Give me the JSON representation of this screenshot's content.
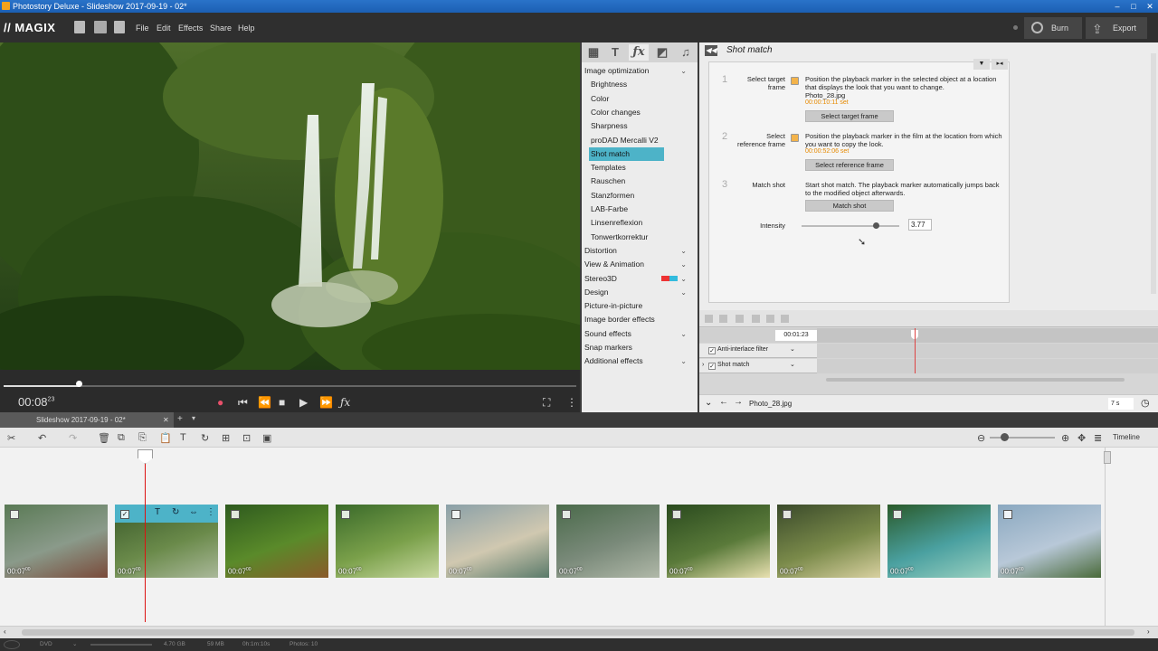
{
  "window": {
    "title": "Photostory Deluxe - Slideshow 2017-09-19 - 02*"
  },
  "menu": {
    "brand": "MAGIX",
    "items": [
      "File",
      "Edit",
      "Effects",
      "Share",
      "Help"
    ],
    "burn_label": "Burn",
    "export_label": "Export"
  },
  "player": {
    "timecode": "00:08",
    "timecode_frames": "23"
  },
  "effects": {
    "items": [
      {
        "label": "Image optimization",
        "type": "cat",
        "chevron": true
      },
      {
        "label": "Brightness",
        "type": "sub"
      },
      {
        "label": "Color",
        "type": "sub"
      },
      {
        "label": "Color changes",
        "type": "sub"
      },
      {
        "label": "Sharpness",
        "type": "sub"
      },
      {
        "label": "proDAD Mercalli V2",
        "type": "sub"
      },
      {
        "label": "Shot match",
        "type": "sub",
        "selected": true
      },
      {
        "label": "Templates",
        "type": "sub"
      },
      {
        "label": "Rauschen",
        "type": "sub"
      },
      {
        "label": "Stanzformen",
        "type": "sub"
      },
      {
        "label": "LAB-Farbe",
        "type": "sub"
      },
      {
        "label": "Linsenreflexion",
        "type": "sub"
      },
      {
        "label": "Tonwertkorrektur",
        "type": "sub"
      },
      {
        "label": "Distortion",
        "type": "cat",
        "chevron": true
      },
      {
        "label": "View & Animation",
        "type": "cat",
        "chevron": true
      },
      {
        "label": "Stereo3D",
        "type": "cat",
        "chevron": true
      },
      {
        "label": "Design",
        "type": "cat",
        "chevron": true
      },
      {
        "label": "Picture-in-picture",
        "type": "cat"
      },
      {
        "label": "Image border effects",
        "type": "cat"
      },
      {
        "label": "Sound effects",
        "type": "cat",
        "chevron": true
      },
      {
        "label": "Snap markers",
        "type": "cat"
      },
      {
        "label": "Additional effects",
        "type": "cat",
        "chevron": true
      }
    ]
  },
  "shotmatch": {
    "title": "Shot match",
    "step1": {
      "num": "1",
      "label": "Select target frame",
      "desc": "Position the playback marker in the selected object at a location that displays the look that you want to change.",
      "file": "Photo_28.jpg",
      "tc": "00:00:10:11 set",
      "button": "Select target frame"
    },
    "step2": {
      "num": "2",
      "label": "Select reference frame",
      "desc": "Position the playback marker in the film at the location from which you want to copy the look.",
      "tc": "00:00:52:06 set",
      "button": "Select reference frame"
    },
    "step3": {
      "num": "3",
      "label": "Match shot",
      "desc": "Start shot match. The playback marker automatically jumps back to the modified object afterwards.",
      "button": "Match shot"
    },
    "intensity": {
      "label": "Intensity",
      "value": "3.77",
      "level": 0.77
    }
  },
  "mini": {
    "timecode": "00:01:23",
    "track1": "Anti-interlace filter",
    "track2": "Shot match",
    "object": "Photo_28.jpg",
    "zoom": "7 s"
  },
  "timeline": {
    "tab": "Slideshow 2017-09-19 - 02*",
    "view_label": "Timeline",
    "clips": [
      {
        "dur": "00:07",
        "frames": "00"
      },
      {
        "dur": "00:07",
        "frames": "00"
      },
      {
        "dur": "00:07",
        "frames": "00"
      },
      {
        "dur": "00:07",
        "frames": "00"
      },
      {
        "dur": "00:07",
        "frames": "00"
      },
      {
        "dur": "00:07",
        "frames": "00"
      },
      {
        "dur": "00:07",
        "frames": "00"
      },
      {
        "dur": "00:07",
        "frames": "00"
      },
      {
        "dur": "00:07",
        "frames": "00"
      },
      {
        "dur": "00:07",
        "frames": "00"
      }
    ]
  },
  "status": {
    "disc": "DVD",
    "size": "4.70 GB",
    "used": "59 MB",
    "duration": "0h:1m:10s",
    "photos": "Photos: 10"
  }
}
